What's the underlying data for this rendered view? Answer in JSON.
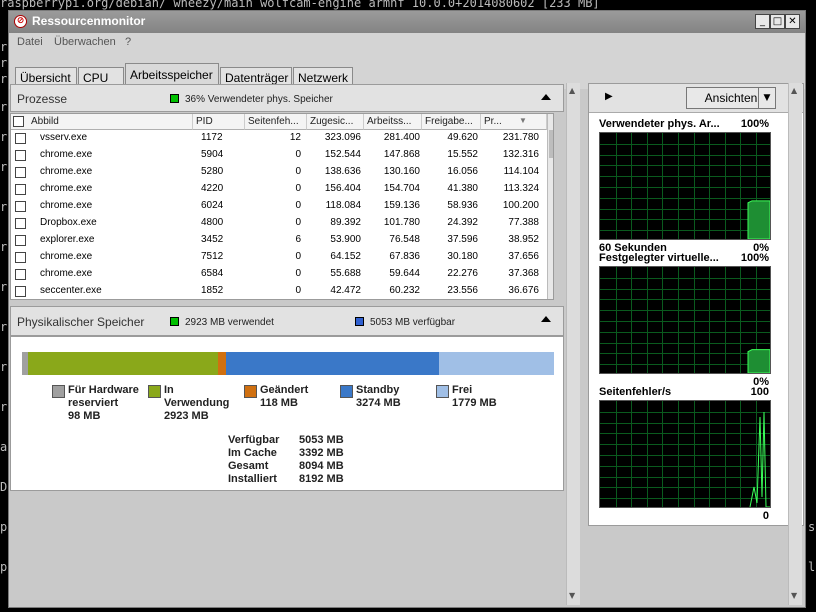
{
  "terminal": {
    "top_line": "raspberrypi.org/debian/ wheezy/main wolfcam-engine armhf 10.0.0+2014080602 [233 MB]"
  },
  "window": {
    "title": "Ressourcenmonitor",
    "controls": {
      "minimize": "_",
      "maximize": "□",
      "close": "✕"
    }
  },
  "menu": {
    "items": [
      "Datei",
      "Überwachen",
      "?"
    ]
  },
  "tabs": [
    {
      "label": "Übersicht",
      "active": false
    },
    {
      "label": "CPU",
      "active": false
    },
    {
      "label": "Arbeitsspeicher",
      "active": true
    },
    {
      "label": "Datenträger",
      "active": false
    },
    {
      "label": "Netzwerk",
      "active": false
    }
  ],
  "processes": {
    "title": "Prozesse",
    "legend_color": "#00c000",
    "legend_text": "36% Verwendeter phys. Speicher",
    "columns": [
      "Abbild",
      "PID",
      "Seitenfeh...",
      "Zugesic...",
      "Arbeitss...",
      "Freigabe...",
      "Pr..."
    ],
    "rows": [
      [
        "vsserv.exe",
        "1172",
        "12",
        "323.096",
        "281.400",
        "49.620",
        "231.780"
      ],
      [
        "chrome.exe",
        "5904",
        "0",
        "152.544",
        "147.868",
        "15.552",
        "132.316"
      ],
      [
        "chrome.exe",
        "5280",
        "0",
        "138.636",
        "130.160",
        "16.056",
        "114.104"
      ],
      [
        "chrome.exe",
        "4220",
        "0",
        "156.404",
        "154.704",
        "41.380",
        "113.324"
      ],
      [
        "chrome.exe",
        "6024",
        "0",
        "118.084",
        "159.136",
        "58.936",
        "100.200"
      ],
      [
        "Dropbox.exe",
        "4800",
        "0",
        "89.392",
        "101.780",
        "24.392",
        "77.388"
      ],
      [
        "explorer.exe",
        "3452",
        "6",
        "53.900",
        "76.548",
        "37.596",
        "38.952"
      ],
      [
        "chrome.exe",
        "7512",
        "0",
        "64.152",
        "67.836",
        "30.180",
        "37.656"
      ],
      [
        "chrome.exe",
        "6584",
        "0",
        "55.688",
        "59.644",
        "22.276",
        "37.368"
      ],
      [
        "seccenter.exe",
        "1852",
        "0",
        "42.472",
        "60.232",
        "23.556",
        "36.676"
      ]
    ]
  },
  "physical": {
    "title": "Physikalischer Speicher",
    "used_text": "2923 MB verwendet",
    "used_color": "#00c000",
    "avail_text": "5053 MB verfügbar",
    "avail_color": "#3060d0",
    "segments": [
      {
        "name": "hardware",
        "mb": 98,
        "color": "#a0a0a0"
      },
      {
        "name": "in-use",
        "mb": 2923,
        "color": "#8aa81a"
      },
      {
        "name": "modified",
        "mb": 118,
        "color": "#d07010"
      },
      {
        "name": "standby",
        "mb": 3274,
        "color": "#3a78c8"
      },
      {
        "name": "free",
        "mb": 1779,
        "color": "#a0bfe6"
      }
    ],
    "legend": [
      {
        "label1": "Für Hardware",
        "label2": "reserviert",
        "value": "98 MB",
        "color": "#a0a0a0"
      },
      {
        "label1": "In",
        "label2": "Verwendung",
        "value": "2923 MB",
        "color": "#8aa81a"
      },
      {
        "label1": "Geändert",
        "label2": "",
        "value": "118 MB",
        "color": "#d07010"
      },
      {
        "label1": "Standby",
        "label2": "",
        "value": "3274 MB",
        "color": "#3a78c8"
      },
      {
        "label1": "Frei",
        "label2": "",
        "value": "1779 MB",
        "color": "#a0bfe6"
      }
    ],
    "stats": [
      {
        "label": "Verfügbar",
        "value": "5053 MB"
      },
      {
        "label": "Im Cache",
        "value": "3392 MB"
      },
      {
        "label": "Gesamt",
        "value": "8094 MB"
      },
      {
        "label": "Installiert",
        "value": "8192 MB"
      }
    ]
  },
  "right": {
    "play_icon": "▶",
    "view_button": "Ansichten",
    "graphs": [
      {
        "title": "Verwendeter phys. Ar...",
        "top_value": "100%",
        "bottom_left": "60 Sekunden",
        "bottom_value": "0%",
        "level": 0.36
      },
      {
        "title": "Festgelegter virtuelle...",
        "top_value": "100%",
        "bottom_left": "",
        "bottom_value": "0%",
        "level": 0.22
      },
      {
        "title": "Seitenfehler/s",
        "top_value": "100",
        "bottom_left": "",
        "bottom_value": "0",
        "level": 0.0
      }
    ]
  }
}
